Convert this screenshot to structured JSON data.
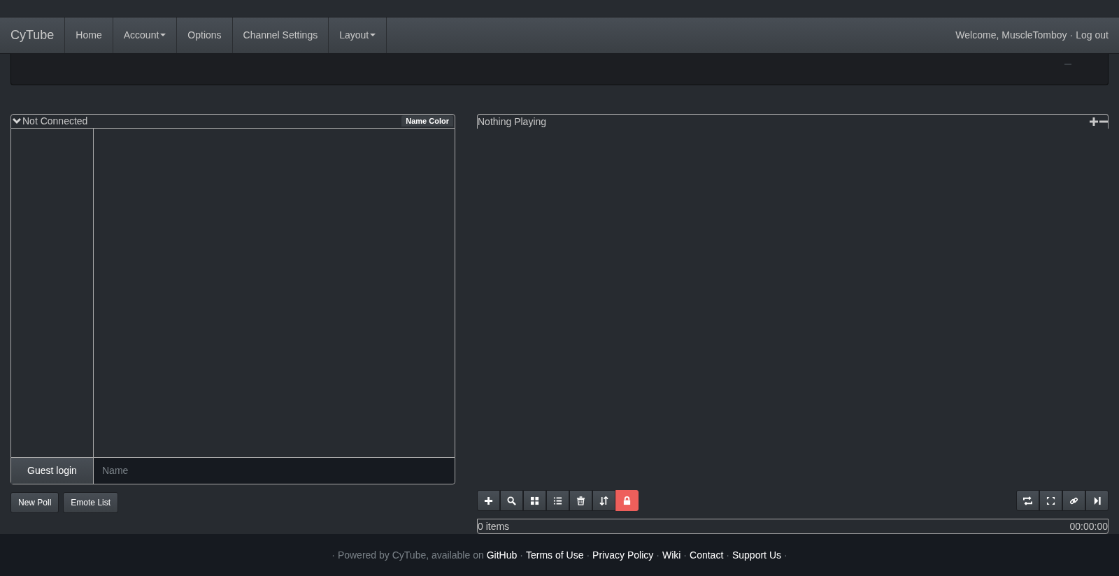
{
  "navbar": {
    "brand": "CyTube",
    "items": [
      {
        "label": "Home",
        "dropdown": false
      },
      {
        "label": "Account",
        "dropdown": true
      },
      {
        "label": "Options",
        "dropdown": false
      },
      {
        "label": "Channel Settings",
        "dropdown": false
      },
      {
        "label": "Layout",
        "dropdown": true
      }
    ],
    "welcome": "Welcome, MuscleTomboy",
    "separator": "·",
    "logout": "Log out"
  },
  "chat": {
    "status": "Not Connected",
    "name_color_button": "Name Color",
    "login_button": "Guest login",
    "name_placeholder": "Name",
    "buttons": [
      "New Poll",
      "Emote List"
    ]
  },
  "video": {
    "title": "Nothing Playing"
  },
  "playlist": {
    "controls_left": [
      {
        "kind": "add",
        "active": false
      },
      {
        "kind": "search",
        "active": false
      },
      {
        "kind": "grid",
        "active": false
      },
      {
        "kind": "list",
        "active": false
      },
      {
        "kind": "trash",
        "active": false
      },
      {
        "kind": "sort",
        "active": false
      },
      {
        "kind": "lock",
        "active": true
      }
    ],
    "controls_right": [
      {
        "kind": "repeat",
        "active": false
      },
      {
        "kind": "fullscreen",
        "active": false
      },
      {
        "kind": "link",
        "active": false
      },
      {
        "kind": "skip",
        "active": false
      }
    ],
    "count": "0 items",
    "duration": "00:00:00"
  },
  "footer": {
    "lead": "· Powered by CyTube, available on",
    "links": [
      "GitHub",
      "Terms of Use",
      "Privacy Policy",
      "Wiki",
      "Contact",
      "Support Us"
    ],
    "separator": "·"
  }
}
